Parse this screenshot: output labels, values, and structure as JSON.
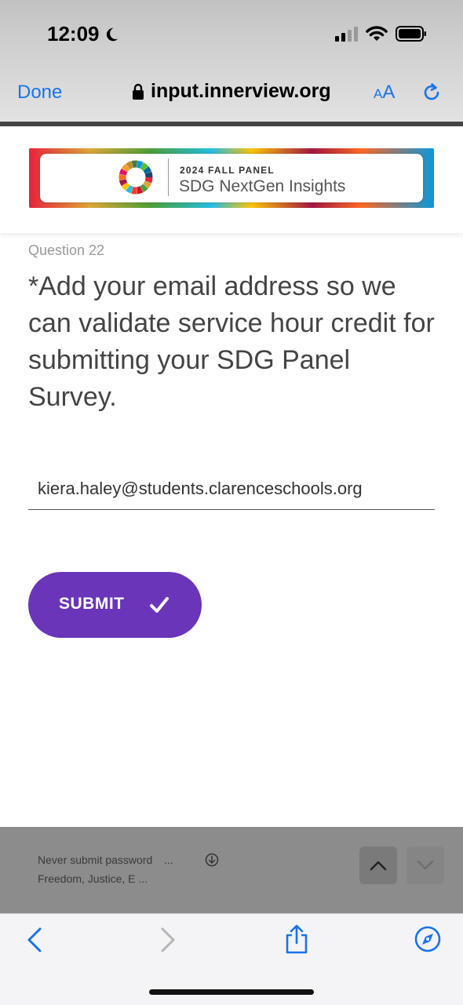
{
  "status_bar": {
    "time": "12:09",
    "icons": [
      "moon-icon",
      "signal-icon",
      "wifi-icon",
      "battery-icon"
    ]
  },
  "browser": {
    "done_label": "Done",
    "url": "input.innerview.org",
    "text_size_small": "A",
    "text_size_large": "A",
    "icons": [
      "lock-icon",
      "reload-icon"
    ]
  },
  "banner": {
    "kicker": "2024 FALL PANEL",
    "title": "SDG NextGen Insights"
  },
  "question": {
    "number": "Question 22",
    "text": "*Add your email address so we can validate service hour credit for submitting your SDG Panel Survey.",
    "email_value": "kiera.haley@students.clarenceschools.org"
  },
  "submit": {
    "label": "SUBMIT",
    "color": "#6a35b8"
  },
  "autofill": {
    "line1": "Never submit password",
    "line1_more": "...",
    "line2": "Freedom, Justice, E ..."
  },
  "toolbar": {
    "icons": [
      "back-icon",
      "forward-icon",
      "share-icon",
      "compass-icon"
    ],
    "accent": "#1a73e8"
  }
}
